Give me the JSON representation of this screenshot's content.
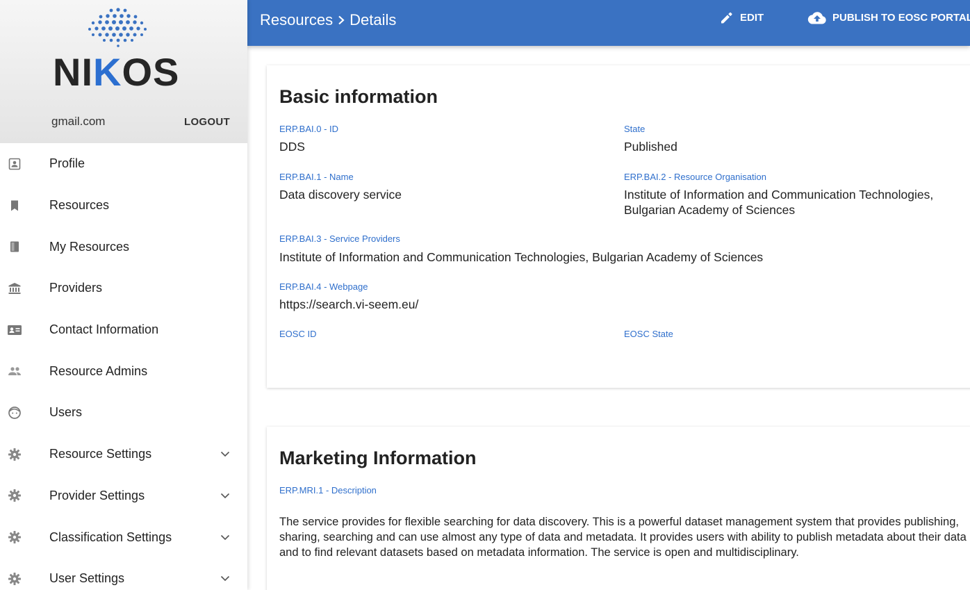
{
  "brand": {
    "name_left": "NI",
    "name_k": "K",
    "name_right": "OS"
  },
  "user": {
    "email": "gmail.com",
    "logout_label": "LOGOUT"
  },
  "sidebar": {
    "items": [
      {
        "label": "Profile",
        "icon": "profile-icon"
      },
      {
        "label": "Resources",
        "icon": "bookmark-icon"
      },
      {
        "label": "My Resources",
        "icon": "book-icon"
      },
      {
        "label": "Providers",
        "icon": "bank-icon"
      },
      {
        "label": "Contact Information",
        "icon": "contact-card-icon"
      },
      {
        "label": "Resource Admins",
        "icon": "people-icon"
      },
      {
        "label": "Users",
        "icon": "face-icon"
      },
      {
        "label": "Resource Settings",
        "icon": "gear-icon",
        "expandable": true
      },
      {
        "label": "Provider Settings",
        "icon": "gear-icon",
        "expandable": true
      },
      {
        "label": "Classification Settings",
        "icon": "gear-icon",
        "expandable": true
      },
      {
        "label": "User Settings",
        "icon": "gear-icon",
        "expandable": true
      }
    ]
  },
  "header": {
    "breadcrumb": [
      "Resources",
      "Details"
    ],
    "edit_label": "EDIT",
    "publish_label": "PUBLISH TO EOSC PORTAL"
  },
  "basic": {
    "title": "Basic information",
    "id_label": "ERP.BAI.0 - ID",
    "id_value": "DDS",
    "state_label": "State",
    "state_value": "Published",
    "name_label": "ERP.BAI.1 - Name",
    "name_value": "Data discovery service",
    "org_label": "ERP.BAI.2 - Resource Organisation",
    "org_value_1": "Institute of Information and Communication Technologies,",
    "org_value_2": "Bulgarian Academy of Sciences",
    "providers_label": "ERP.BAI.3 - Service Providers",
    "providers_value": "Institute of Information and Communication Technologies, Bulgarian Academy of Sciences",
    "webpage_label": "ERP.BAI.4 - Webpage",
    "webpage_value": "https://search.vi-seem.eu/",
    "eosc_id_label": "EOSC ID",
    "eosc_state_label": "EOSC State"
  },
  "marketing": {
    "title": "Marketing Information",
    "desc_label": "ERP.MRI.1 - Description",
    "desc_value": "The service provides for flexible searching for data discovery. This is a powerful dataset management system that provides publishing, sharing, searching and can use almost any type of data and metadata. It provides users with ability to publish metadata about their data and to find relevant datasets based on metadata information. The service is open and multidisciplinary."
  },
  "colors": {
    "topbar": "#3a72c2",
    "label_blue": "#2f6fcc",
    "logo_blue": "#2c6fd0"
  }
}
